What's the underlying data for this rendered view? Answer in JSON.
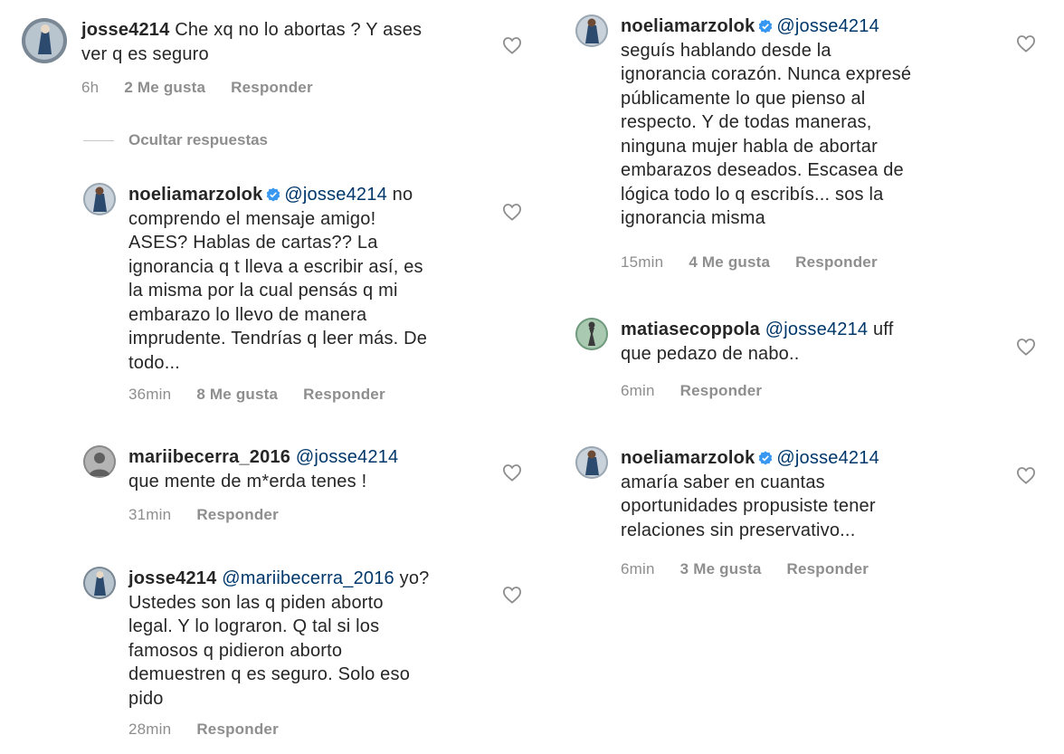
{
  "comments": {
    "c1": {
      "username": "josse4214",
      "lines": [
        "Che xq no lo abortas ? Y ases",
        "ver q es seguro"
      ],
      "time": "6h",
      "likes": "2 Me gusta",
      "reply": "Responder"
    },
    "hide_replies": "Ocultar respuestas",
    "c2": {
      "username": "noeliamarzolok",
      "mention": "@josse4214",
      "first_tail": " no",
      "lines": [
        "comprendo el mensaje amigo!",
        "ASES? Hablas de cartas?? La",
        "ignorancia q t lleva a escribir así, es",
        "la misma por la cual pensás q mi",
        "embarazo lo llevo de manera",
        "imprudente. Tendrías q leer más. De",
        "todo..."
      ],
      "time": "36min",
      "likes": "8 Me gusta",
      "reply": "Responder"
    },
    "c3": {
      "username": "mariibecerra_2016",
      "mention": "@josse4214",
      "lines": [
        "que mente de m*erda tenes !"
      ],
      "time": "31min",
      "reply": "Responder"
    },
    "c4": {
      "username": "josse4214",
      "mention": "@mariibecerra_2016",
      "first_tail": " yo?",
      "lines": [
        "Ustedes son las q piden aborto",
        "legal. Y lo lograron. Q tal si los",
        "famosos q pidieron aborto",
        "demuestren q es seguro. Solo eso",
        "pido"
      ],
      "time": "28min",
      "reply": "Responder"
    },
    "c5": {
      "username": "noeliamarzolok",
      "mention": "@josse4214",
      "lines": [
        "seguís hablando desde la",
        "ignorancia corazón. Nunca expresé",
        "públicamente lo que pienso al",
        "respecto. Y de todas maneras,",
        "ninguna mujer habla de abortar",
        "embarazos deseados. Escasea de",
        "lógica todo lo q escribís... sos la",
        "ignorancia misma"
      ],
      "time": "15min",
      "likes": "4 Me gusta",
      "reply": "Responder"
    },
    "c6": {
      "username": "matiasecoppola",
      "mention": "@josse4214",
      "first_tail": " uff",
      "lines": [
        "que pedazo de nabo.."
      ],
      "time": "6min",
      "reply": "Responder"
    },
    "c7": {
      "username": "noeliamarzolok",
      "mention": "@josse4214",
      "lines": [
        "amaría saber en cuantas",
        "oportunidades propusiste tener",
        "relaciones sin preservativo..."
      ],
      "time": "6min",
      "likes": "3 Me gusta",
      "reply": "Responder"
    }
  },
  "icons": {
    "like": "heart-outline-icon",
    "verified": "verified-badge-icon"
  },
  "colors": {
    "text": "#262626",
    "meta": "#8e8e8e",
    "mention": "#00376b",
    "verified": "#3897f0"
  }
}
